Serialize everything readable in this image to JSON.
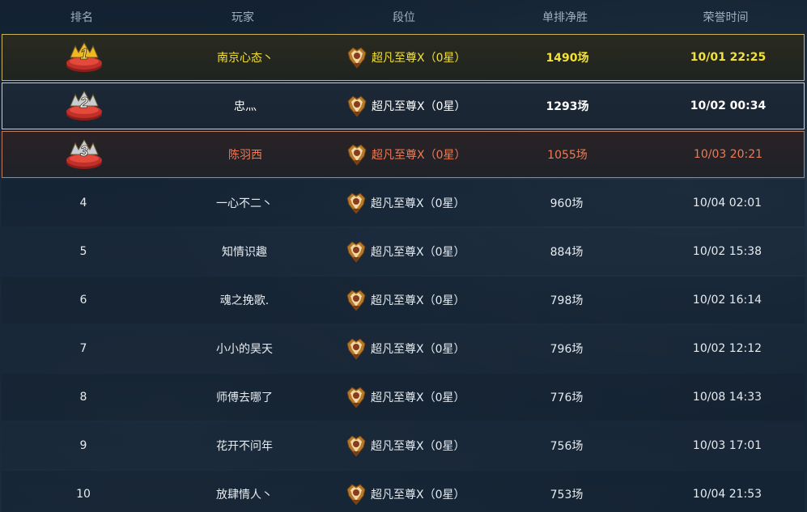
{
  "header": {
    "rank": "排名",
    "player": "玩家",
    "tier": "段位",
    "wins": "单排净胜",
    "time": "荣誉时间"
  },
  "rows": [
    {
      "rank": "1",
      "player": "南京心态丶",
      "tier": "超凡至尊Ⅹ（0星）",
      "wins": "1490场",
      "time": "10/01 22:25"
    },
    {
      "rank": "2",
      "player": "忠灬",
      "tier": "超凡至尊Ⅹ（0星）",
      "wins": "1293场",
      "time": "10/02 00:34"
    },
    {
      "rank": "3",
      "player": "陈羽西",
      "tier": "超凡至尊Ⅹ（0星）",
      "wins": "1055场",
      "time": "10/03 20:21"
    },
    {
      "rank": "4",
      "player": "一心不二丶",
      "tier": "超凡至尊Ⅹ（0星）",
      "wins": "960场",
      "time": "10/04 02:01"
    },
    {
      "rank": "5",
      "player": "知情识趣",
      "tier": "超凡至尊Ⅹ（0星）",
      "wins": "884场",
      "time": "10/02 15:38"
    },
    {
      "rank": "6",
      "player": "魂之挽歌.",
      "tier": "超凡至尊Ⅹ（0星）",
      "wins": "798场",
      "time": "10/02 16:14"
    },
    {
      "rank": "7",
      "player": "小小的昊天",
      "tier": "超凡至尊Ⅹ（0星）",
      "wins": "796场",
      "time": "10/02 12:12"
    },
    {
      "rank": "8",
      "player": "师傅去哪了",
      "tier": "超凡至尊Ⅹ（0星）",
      "wins": "776场",
      "time": "10/08 14:33"
    },
    {
      "rank": "9",
      "player": "花开不问年",
      "tier": "超凡至尊Ⅹ（0星）",
      "wins": "756场",
      "time": "10/03 17:01"
    },
    {
      "rank": "10",
      "player": "放肆情人丶",
      "tier": "超凡至尊Ⅹ（0星）",
      "wins": "753场",
      "time": "10/04 21:53"
    }
  ],
  "icons": {
    "medal": "rank-medal-icon",
    "tier": "tier-badge-icon"
  },
  "colors": {
    "gold": "#f2e13a",
    "silver": "#ffffff",
    "bronze": "#ef7a54"
  }
}
